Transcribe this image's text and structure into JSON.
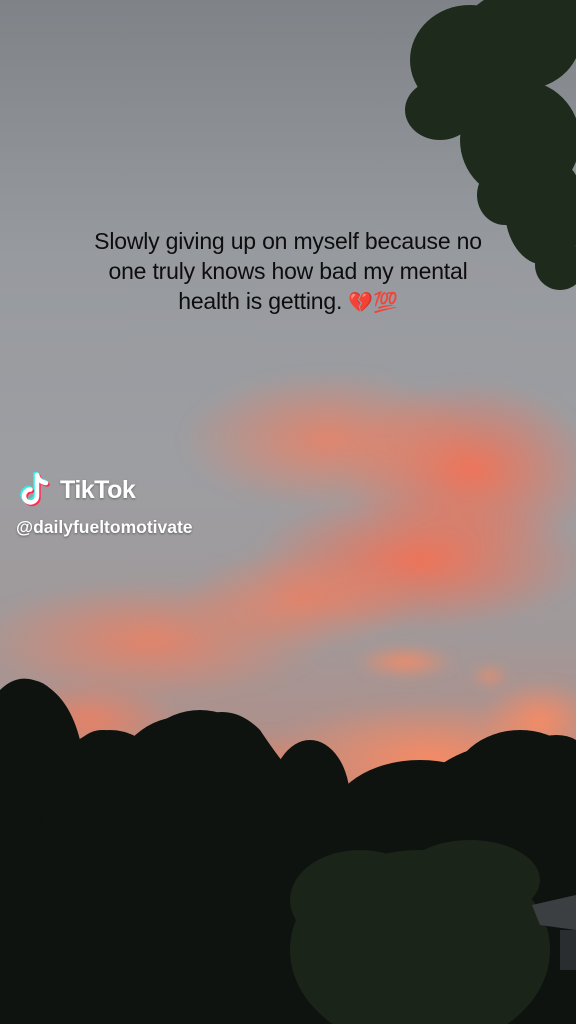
{
  "caption": {
    "line1": "Slowly giving up on myself because no",
    "line2": "one truly knows how bad my mental",
    "line3": "health is getting.",
    "emoji": "💔💯"
  },
  "watermark": {
    "brand": "TikTok",
    "handle": "@dailyfueltomotivate",
    "logo_icon": "tiktok-note-icon"
  },
  "colors": {
    "sky_top": "#7f8387",
    "sky_mid": "#999ca0",
    "sunset_glow": "#ff6a4d",
    "tree_silhouette": "#101410",
    "text_dark": "#0d0d0d",
    "text_light": "#ffffff"
  }
}
